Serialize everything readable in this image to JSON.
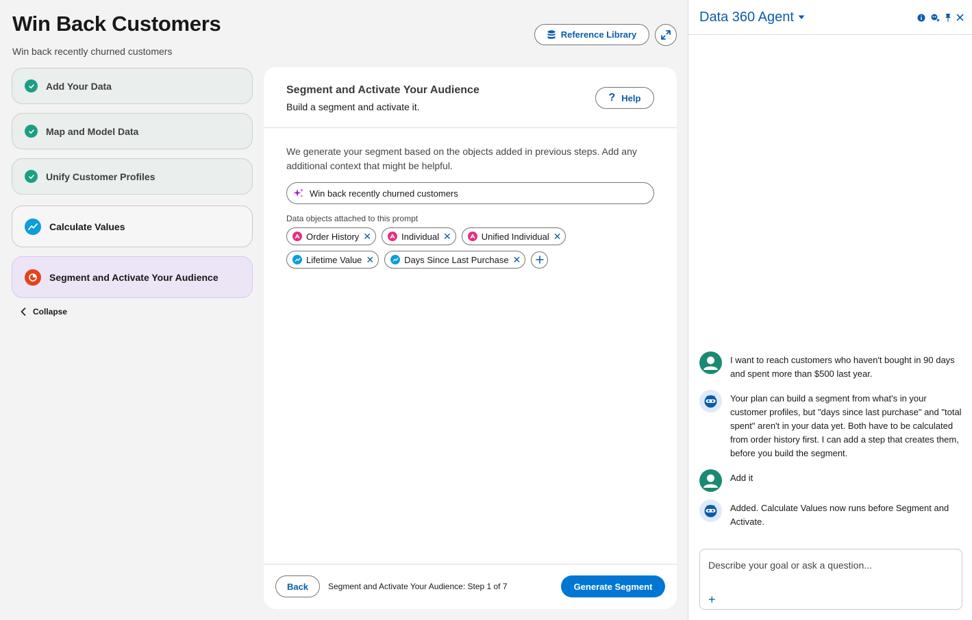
{
  "header": {
    "title": "Win Back Customers",
    "subtitle": "Win back recently churned customers",
    "reference_library_label": "Reference Library"
  },
  "steps": [
    {
      "label": "Add Your Data",
      "status": "done"
    },
    {
      "label": "Map and Model Data",
      "status": "done"
    },
    {
      "label": "Unify Customer Profiles",
      "status": "done"
    },
    {
      "label": "Calculate Values",
      "status": "todo"
    },
    {
      "label": "Segment and Activate Your Audience",
      "status": "active"
    }
  ],
  "collapse_label": "Collapse",
  "card": {
    "title": "Segment and Activate Your Audience",
    "subtitle": "Build a segment and activate it.",
    "help_label": "Help",
    "description": "We generate your segment based on the objects added in previous steps. Add any additional context that might be helpful.",
    "prompt_value": "Win back recently churned customers",
    "objects_label": "Data objects attached to this prompt",
    "objects_row1": [
      "Order History",
      "Individual",
      "Unified Individual"
    ],
    "objects_row2": [
      "Lifetime Value",
      "Days Since Last Purchase"
    ],
    "back_label": "Back",
    "step_status": "Segment and Activate Your Audience: Step 1 of 7",
    "generate_label": "Generate Segment"
  },
  "agent": {
    "title": "Data 360 Agent",
    "messages": [
      {
        "role": "user",
        "text": "I want to reach customers who haven't bought in 90 days and spent more than $500 last year."
      },
      {
        "role": "bot",
        "text": "Your plan can build a segment from what's in your customer profiles, but \"days since last purchase\" and \"total spent\" aren't in your data yet. Both have to be calculated from order history first. I can add a step that creates them, before you build the segment."
      },
      {
        "role": "user",
        "text": "Add it"
      },
      {
        "role": "bot",
        "text": "Added. Calculate Values now runs before Segment and Activate."
      }
    ],
    "input_placeholder": "Describe your goal or ask a question..."
  },
  "colors": {
    "brand_blue": "#0176d3",
    "link_blue": "#0b5cab",
    "success_green": "#1b9e84",
    "active_step_bg": "#ece5f6"
  }
}
